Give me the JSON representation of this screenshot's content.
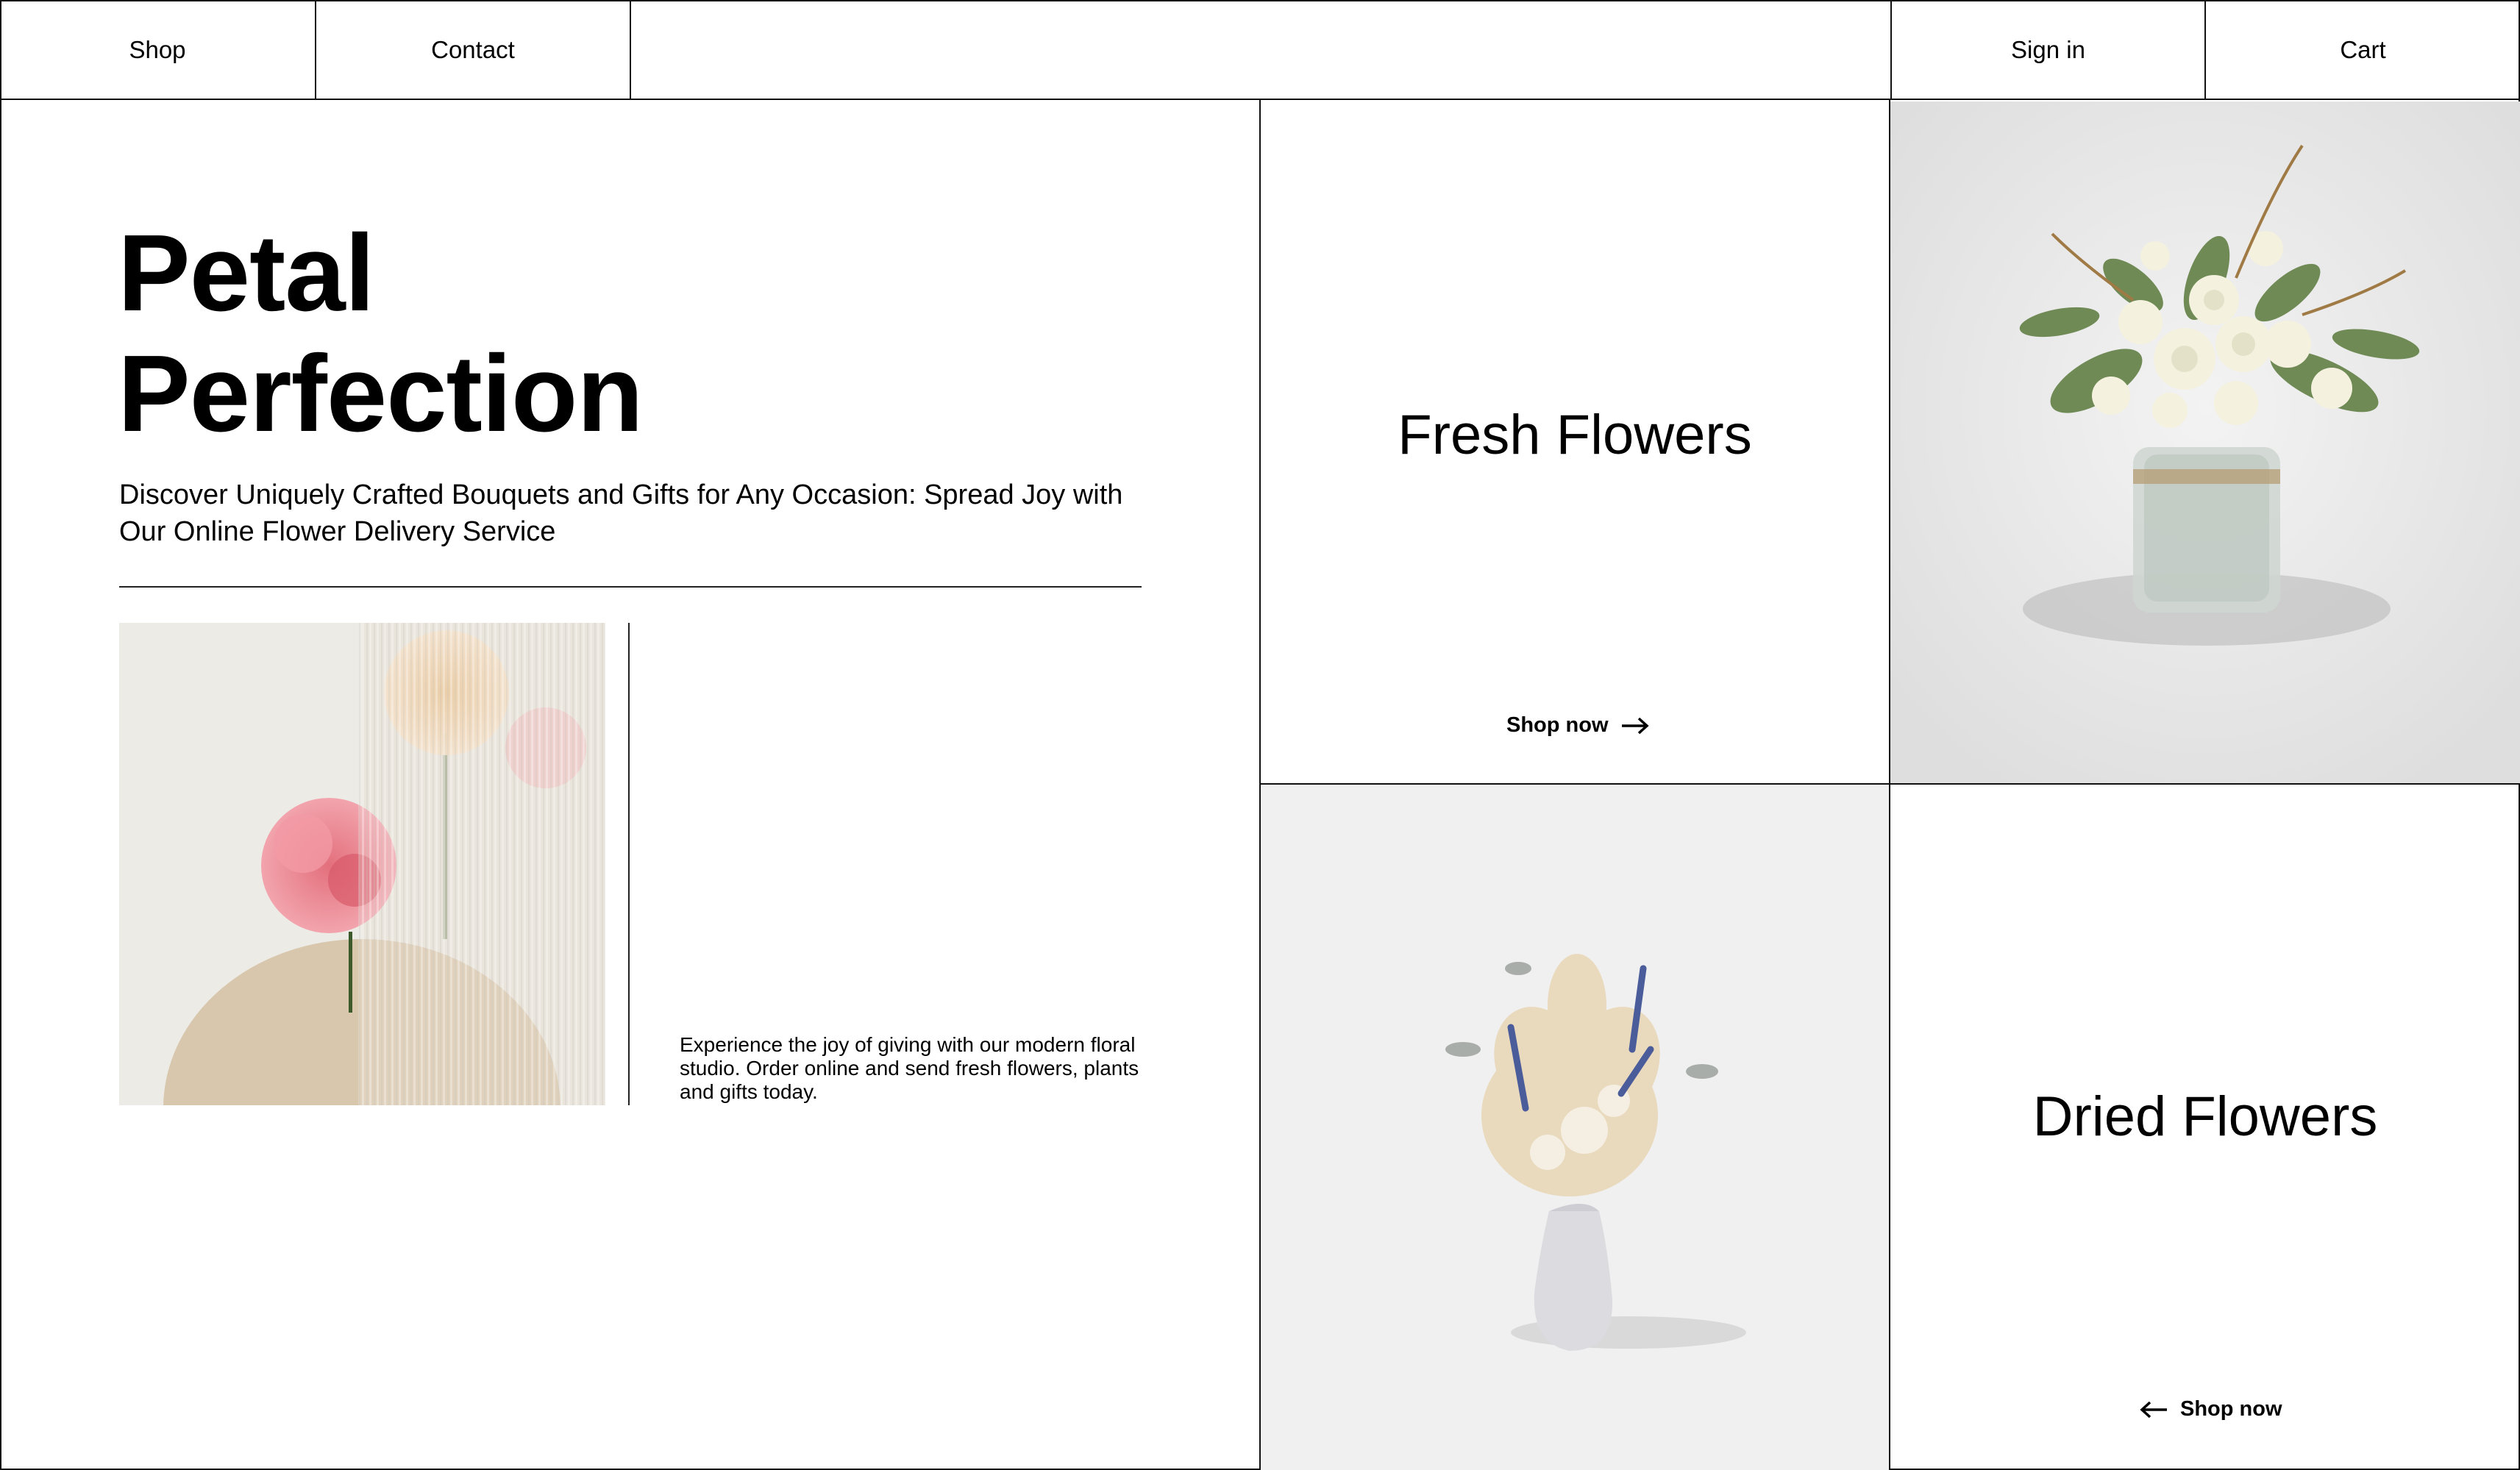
{
  "nav": {
    "shop": "Shop",
    "contact": "Contact",
    "sign_in": "Sign in",
    "cart": "Cart"
  },
  "hero": {
    "title_line1": "Petal",
    "title_line2": "Perfection",
    "subtitle": "Discover Uniquely Crafted Bouquets and Gifts for Any Occasion: Spread Joy with Our Online Flower Delivery Service",
    "note": "Experience the joy of giving with our modern floral studio. Order online and send fresh flowers, plants and gifts today."
  },
  "tiles": {
    "fresh": {
      "title": "Fresh Flowers",
      "link": "Shop now",
      "icon": "arrow-right-icon"
    },
    "dried": {
      "title": "Dried Flowers",
      "link": "Shop now",
      "icon": "arrow-left-icon"
    }
  },
  "colors": {
    "line": "#111111",
    "background": "#ffffff",
    "photo_bg": "#efefef"
  }
}
